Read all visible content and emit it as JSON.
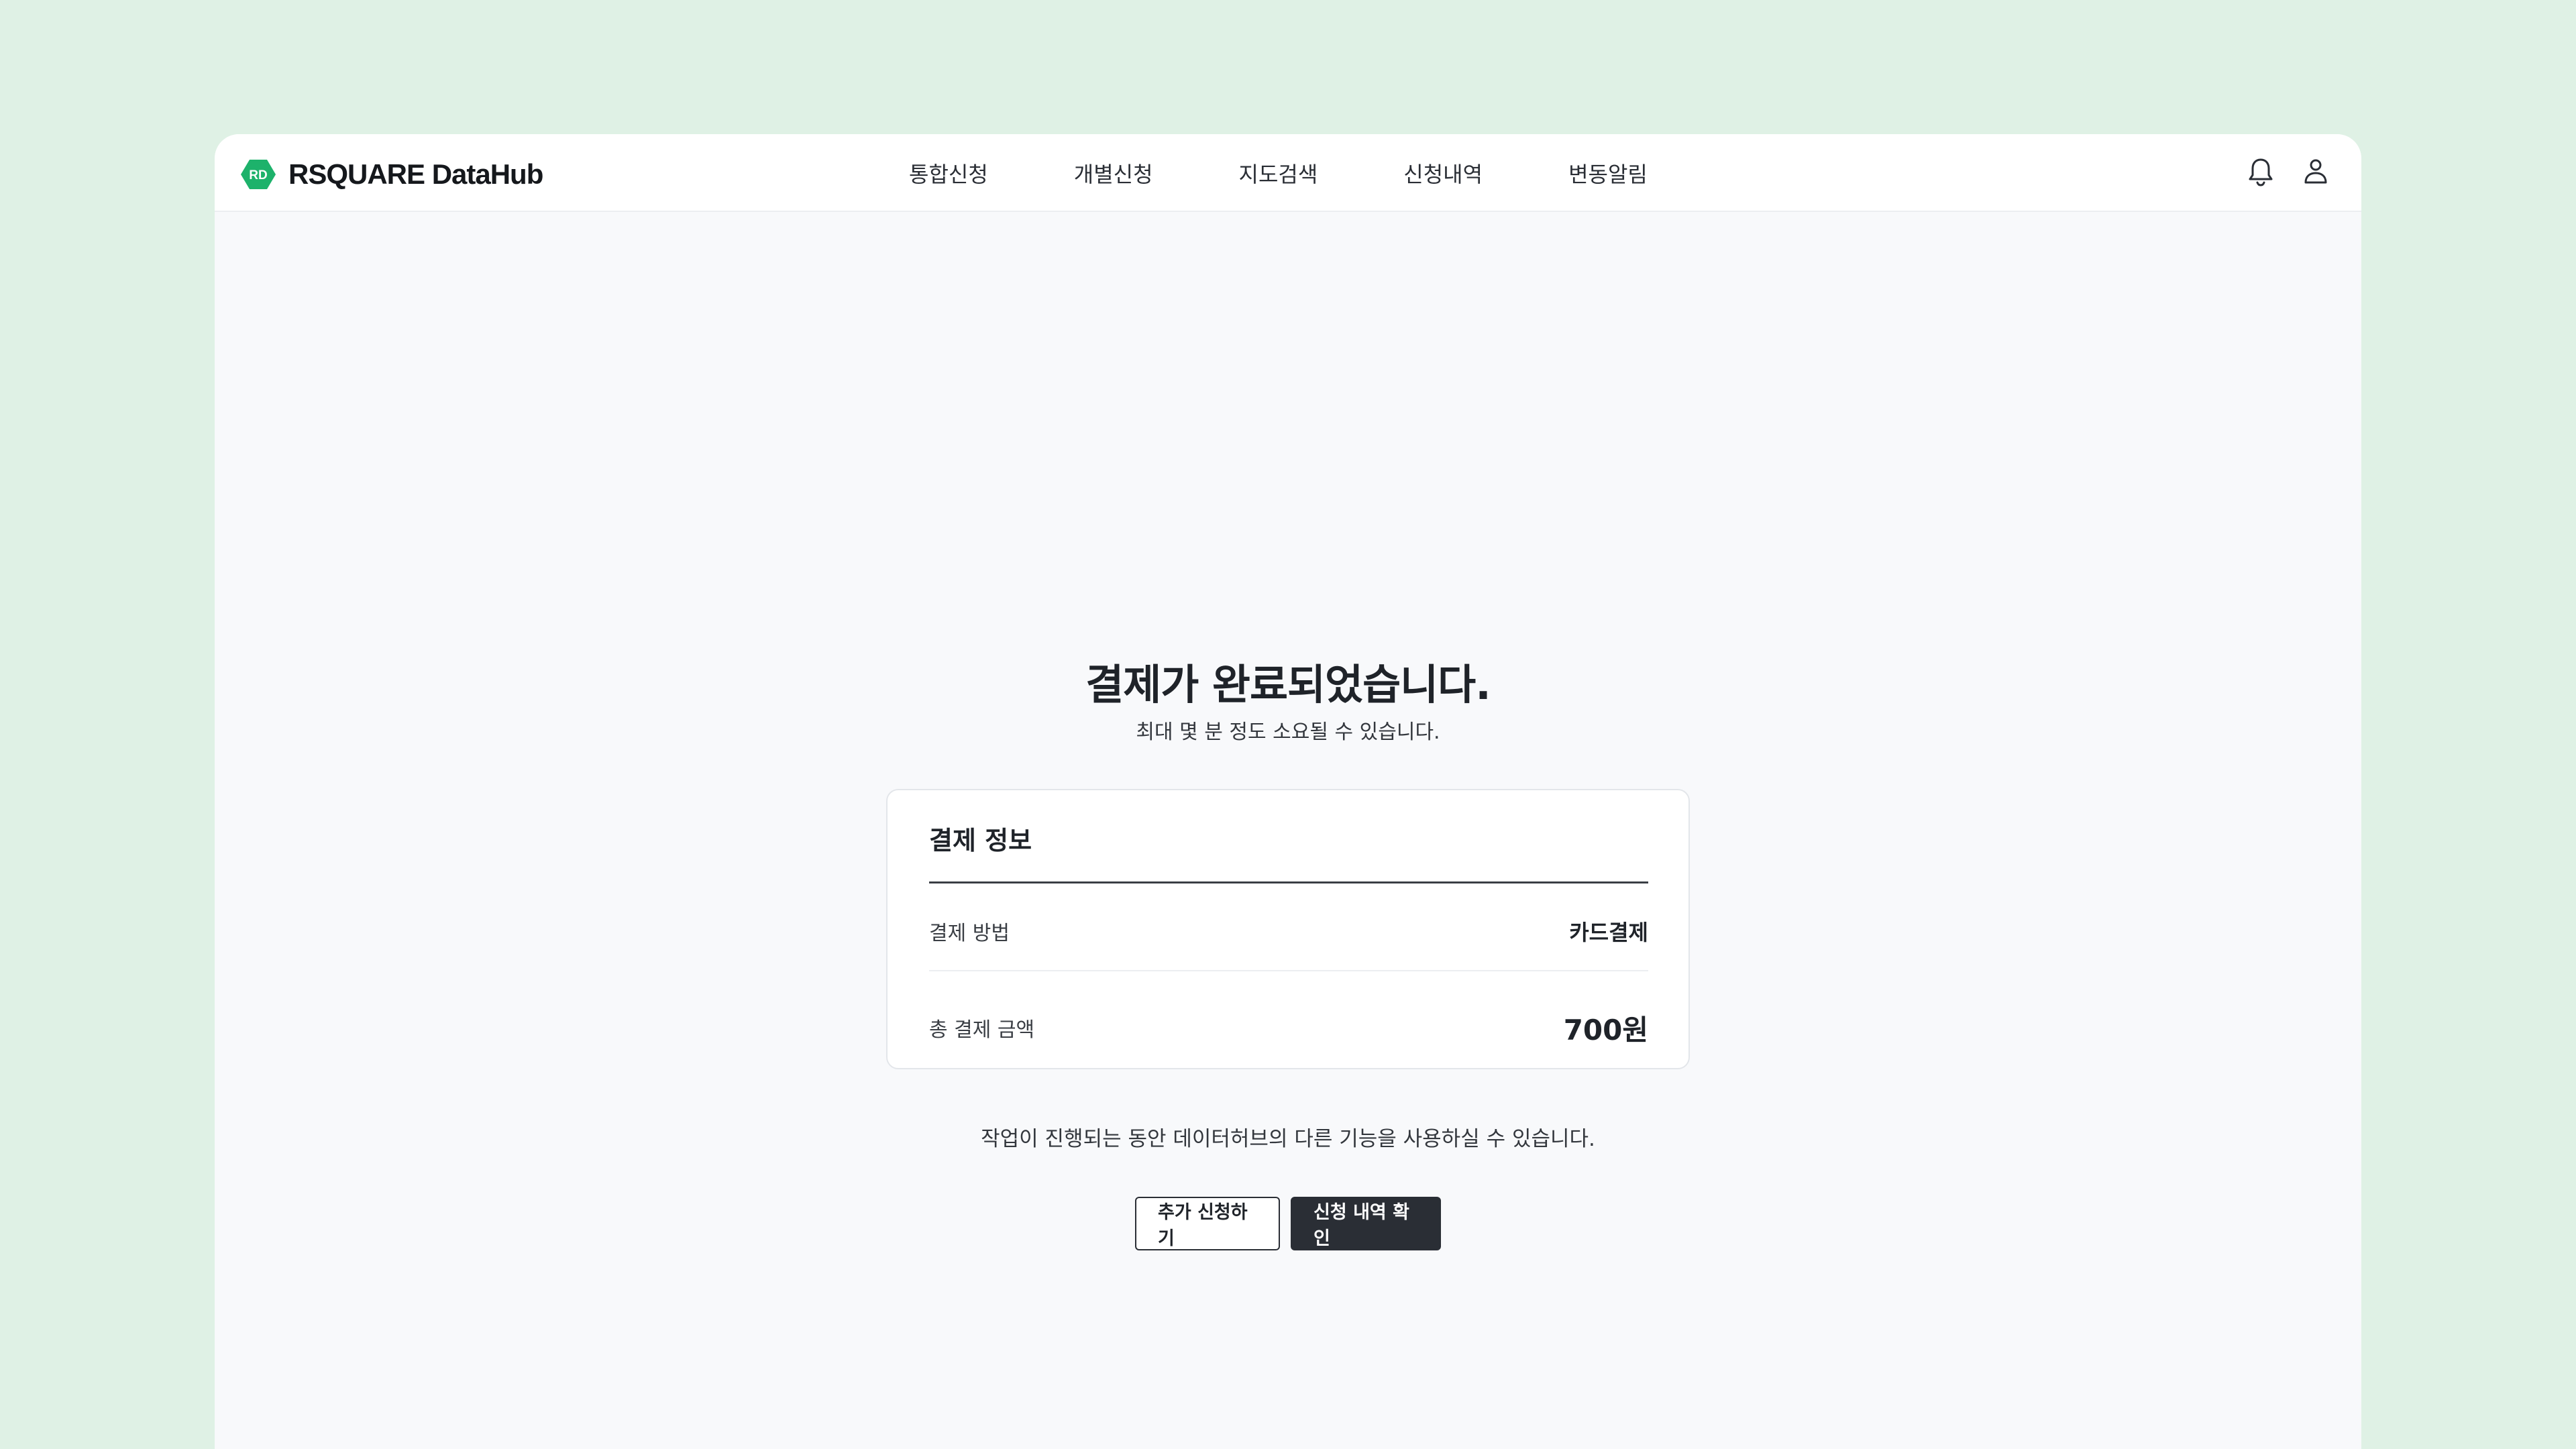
{
  "header": {
    "logo_badge": "RD",
    "logo_text": "RSQUARE DataHub",
    "brand_color": "#1db26b",
    "nav": [
      {
        "label": "통합신청"
      },
      {
        "label": "개별신청"
      },
      {
        "label": "지도검색"
      },
      {
        "label": "신청내역"
      },
      {
        "label": "변동알림"
      }
    ],
    "icons": [
      "bell-icon",
      "user-icon"
    ]
  },
  "main": {
    "title": "결제가 완료되었습니다.",
    "subtitle": "최대 몇 분 정도 소요될 수 있습니다.",
    "card": {
      "title": "결제 정보",
      "rows": [
        {
          "label": "결제 방법",
          "value": "카드결제"
        },
        {
          "label": "총 결제 금액",
          "value": "700원"
        }
      ]
    },
    "note": "작업이 진행되는 동안 데이터허브의 다른 기능을 사용하실 수 있습니다.",
    "buttons": {
      "secondary": "추가 신청하기",
      "primary": "신청 내역 확인"
    }
  }
}
